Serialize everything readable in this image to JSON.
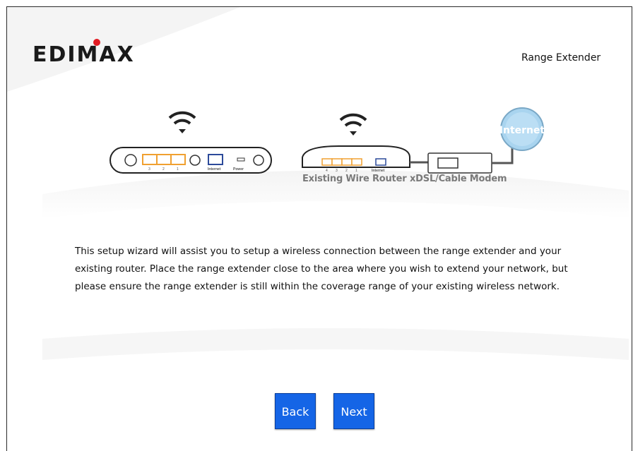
{
  "header": {
    "brand": "EDIMAX",
    "product_name": "Range Extender"
  },
  "diagram": {
    "router_caption": "Existing Wire Router",
    "modem_caption": "xDSL/Cable Modem",
    "internet_label": "Internet",
    "extender_ports": [
      "3",
      "2",
      "1"
    ],
    "extender_port_internet": "Internet",
    "extender_port_power": "Power",
    "router_ports": [
      "4",
      "3",
      "2",
      "1"
    ],
    "router_port_internet": "Internet"
  },
  "content": {
    "intro_text": "This setup wizard will assist you to setup a wireless connection between the range extender and your existing router. Place the range extender close to the area where you wish to extend your network, but please ensure the range extender is still within the coverage range of your existing wireless network."
  },
  "buttons": {
    "back_label": "Back",
    "next_label": "Next"
  },
  "colors": {
    "button_bg": "#1565e6",
    "logo_red": "#e21b23",
    "port_orange": "#f0a030",
    "internet_globe": "#a9d4ef"
  }
}
